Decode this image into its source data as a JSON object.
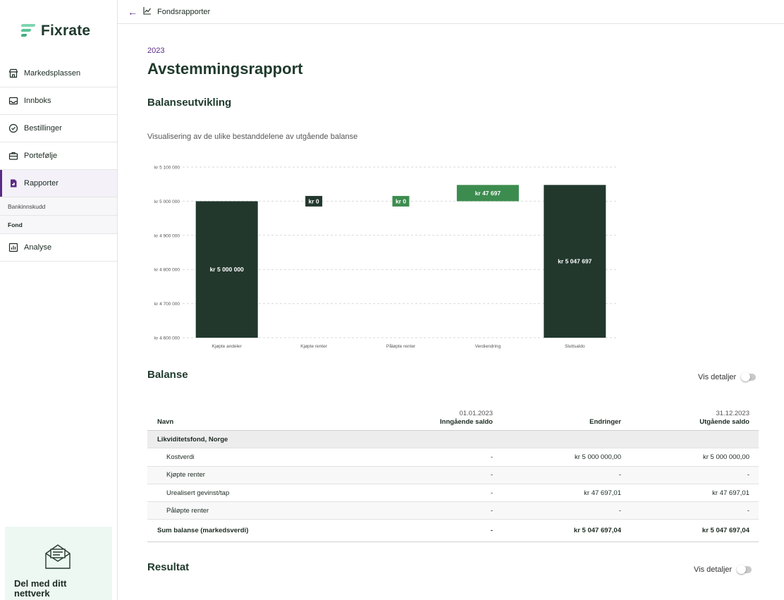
{
  "brand": {
    "name": "Fixrate"
  },
  "sidebar": {
    "items": [
      {
        "label": "Markedsplassen",
        "icon": "store-icon"
      },
      {
        "label": "Innboks",
        "icon": "inbox-icon"
      },
      {
        "label": "Bestillinger",
        "icon": "check-circle-icon"
      },
      {
        "label": "Portefølje",
        "icon": "briefcase-icon"
      },
      {
        "label": "Rapporter",
        "icon": "report-icon"
      },
      {
        "label": "Analyse",
        "icon": "analytics-icon"
      }
    ],
    "subitems": [
      "Bankinnskudd",
      "Fond"
    ],
    "promo": {
      "text": "Del med ditt nettverk"
    }
  },
  "topbar": {
    "breadcrumb": "Fondsrapporter"
  },
  "page": {
    "year": "2023",
    "title": "Avstemmingsrapport",
    "section_chart": "Balanseutvikling",
    "chart_desc": "Visualisering av de ulike bestanddelene av utgående balanse",
    "section_balance": "Balanse",
    "section_result": "Resultat",
    "details_toggle": "Vis detaljer"
  },
  "chart_data": {
    "type": "bar",
    "subtype": "waterfall",
    "categories": [
      "Kjøpte andeler",
      "Kjøpte renter",
      "Påløpte renter",
      "Verdiendring",
      "Sluttsaldo"
    ],
    "values": [
      5000000,
      0,
      0,
      47697,
      5047697
    ],
    "bases": [
      4600000,
      5000000,
      5000000,
      5000000,
      4600000
    ],
    "data_labels": [
      "kr 5 000 000",
      "kr 0",
      "kr 0",
      "kr 47 697",
      "kr 5 047 697"
    ],
    "colors": [
      "#22382d",
      "#22382d",
      "#3d8c4f",
      "#3d8c4f",
      "#22382d"
    ],
    "ylim": [
      4600000,
      5100000
    ],
    "yticks": [
      4600000,
      4700000,
      4800000,
      4900000,
      5000000,
      5100000
    ],
    "ytick_labels": [
      "kr 4 600 000",
      "kr 4 700 000",
      "kr 4 800 000",
      "kr 4 900 000",
      "kr 5 000 000",
      "kr 5 100 000"
    ],
    "grid": true
  },
  "balance_table": {
    "headers": {
      "name": "Navn",
      "in_date": "01.01.2023",
      "in": "Inngående saldo",
      "change": "Endringer",
      "out_date": "31.12.2023",
      "out": "Utgående saldo"
    },
    "group": "Likviditetsfond, Norge",
    "rows": [
      {
        "name": "Kostverdi",
        "in": "-",
        "change": "kr 5 000 000,00",
        "out": "kr 5 000 000,00"
      },
      {
        "name": "Kjøpte renter",
        "in": "-",
        "change": "-",
        "out": "-"
      },
      {
        "name": "Urealisert gevinst/tap",
        "in": "-",
        "change": "kr 47 697,01",
        "out": "kr 47 697,01"
      },
      {
        "name": "Påløpte renter",
        "in": "-",
        "change": "-",
        "out": "-"
      }
    ],
    "sum": {
      "name": "Sum balanse (markedsverdi)",
      "in": "-",
      "change": "kr 5 047 697,04",
      "out": "kr 5 047 697,04"
    }
  }
}
